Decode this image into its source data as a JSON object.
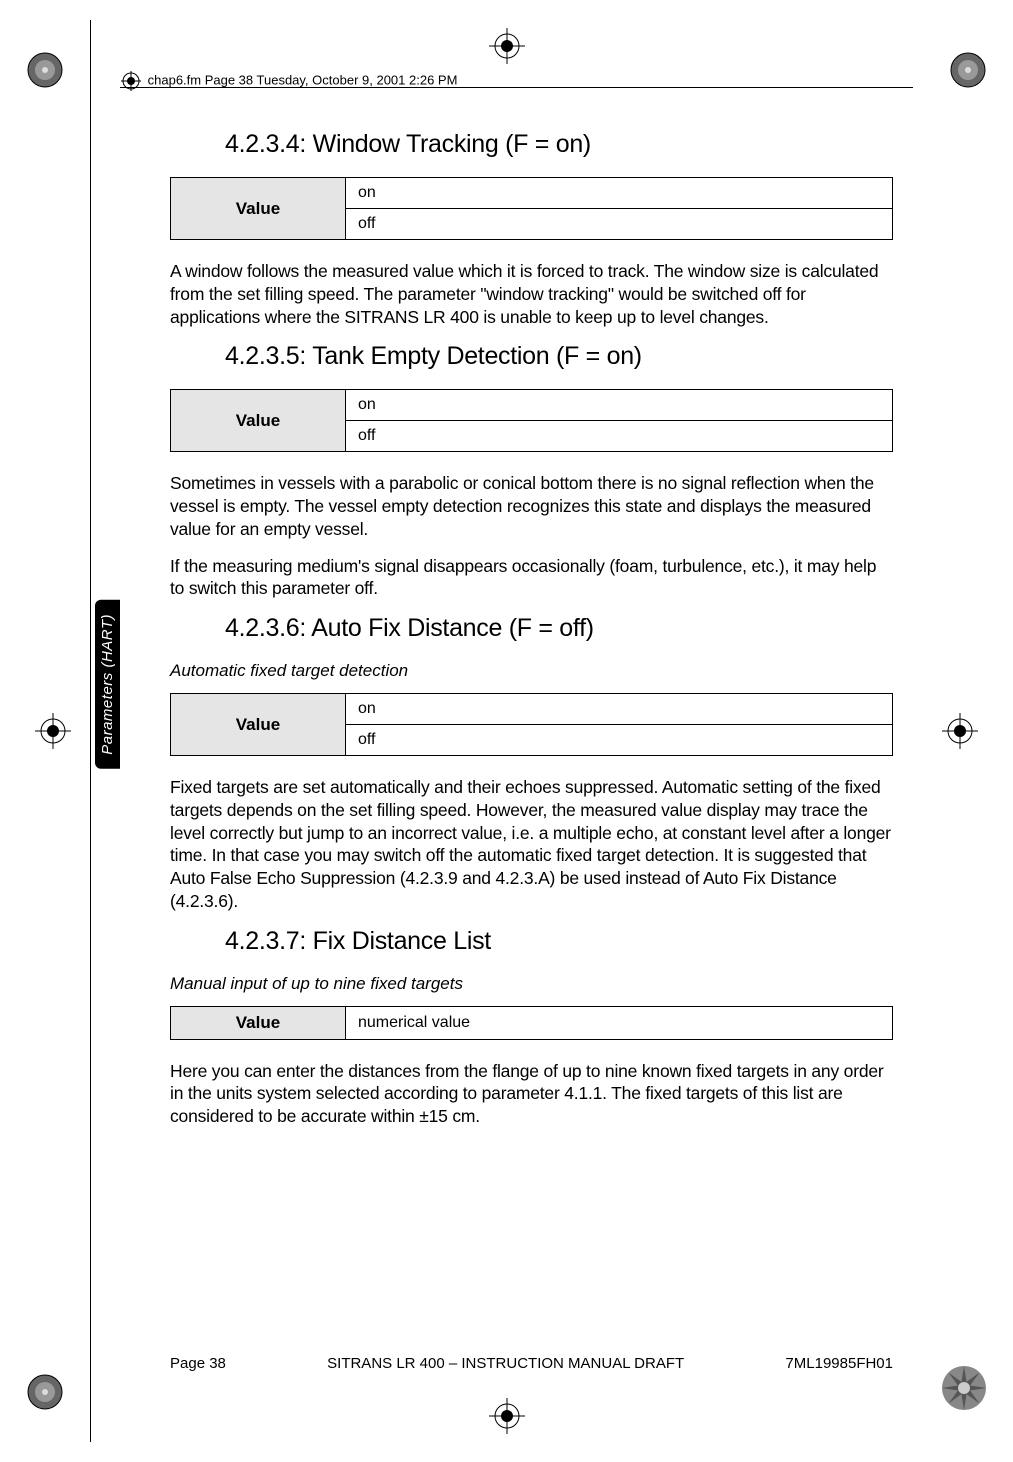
{
  "header": {
    "text": "chap6.fm  Page 38  Tuesday, October 9, 2001  2:26 PM"
  },
  "side_tab": "Parameters (HART)",
  "sections": [
    {
      "heading": "4.2.3.4: Window Tracking (F = on)",
      "table": {
        "label": "Value",
        "rows": [
          "on",
          "off"
        ]
      },
      "paragraphs": [
        "A window follows the measured value which it is forced to track. The window size is calculated from the set filling speed. The parameter \"window tracking\" would be switched off for applications where the SITRANS LR 400 is unable to keep up to level changes."
      ]
    },
    {
      "heading": "4.2.3.5: Tank Empty Detection (F = on)",
      "table": {
        "label": "Value",
        "rows": [
          "on",
          "off"
        ]
      },
      "paragraphs": [
        "Sometimes in vessels with a parabolic or conical bottom there is no signal reflection when the vessel is empty. The vessel empty detection recognizes this state and displays the measured value for an empty vessel.",
        "If the measuring medium's signal disappears occasionally (foam, turbulence, etc.), it may help to switch this parameter off."
      ]
    },
    {
      "heading": "4.2.3.6: Auto Fix Distance (F = off)",
      "italic": "Automatic fixed target detection",
      "table": {
        "label": "Value",
        "rows": [
          "on",
          "off"
        ]
      },
      "paragraphs": [
        "Fixed targets are set automatically and their echoes suppressed. Automatic setting of the fixed targets depends on the set filling speed. However, the measured value display may trace the level correctly but jump to an incorrect value, i.e. a multiple echo, at constant level after a longer time. In that case you may switch off the automatic fixed target detection. It is suggested that Auto False Echo Suppression (4.2.3.9 and 4.2.3.A) be used instead of Auto Fix Distance (4.2.3.6)."
      ]
    },
    {
      "heading": "4.2.3.7: Fix Distance List",
      "italic": "Manual input of up to nine fixed targets",
      "table_single": {
        "label": "Value",
        "value": "numerical value"
      },
      "paragraphs": [
        "Here you can enter the distances from the flange of up to nine known fixed targets in any order in the units system selected according to parameter 4.1.1. The fixed targets of this list are considered to be accurate within ±15 cm."
      ]
    }
  ],
  "footer": {
    "left": "Page 38",
    "center": "SITRANS LR 400 – INSTRUCTION MANUAL DRAFT",
    "right": "7ML19985FH01"
  }
}
